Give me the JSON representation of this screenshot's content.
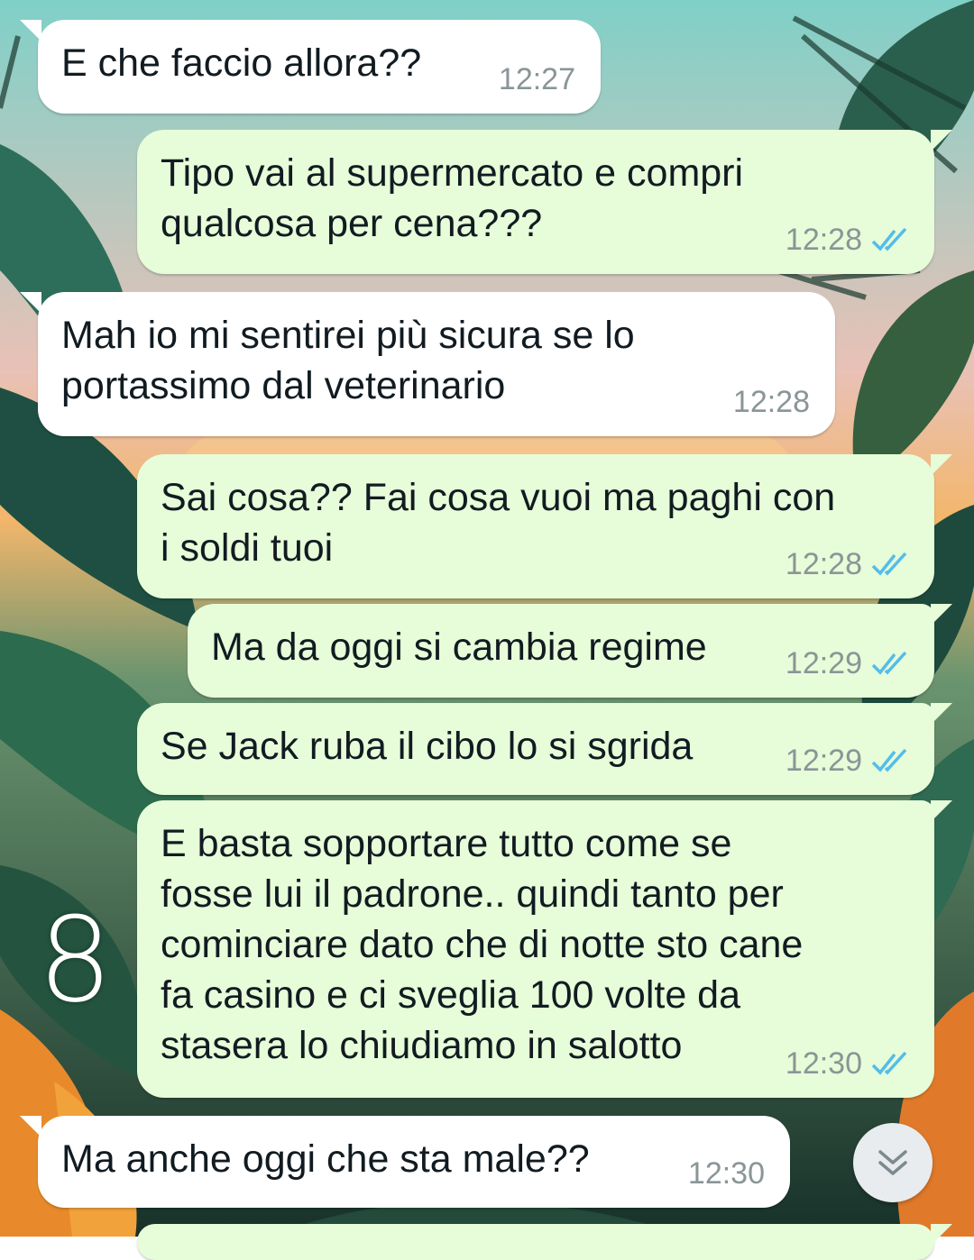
{
  "messages": [
    {
      "dir": "in",
      "text": "E che faccio allora??",
      "time": "12:27"
    },
    {
      "dir": "out",
      "text": "Tipo vai al supermercato e compri\nqualcosa per cena???",
      "time": "12:28"
    },
    {
      "dir": "in",
      "text": "Mah io mi sentirei più sicura se lo\nportassimo dal veterinario",
      "time": "12:28"
    },
    {
      "dir": "out",
      "text": "Sai cosa?? Fai cosa vuoi ma paghi con\ni soldi tuoi",
      "time": "12:28"
    },
    {
      "dir": "out",
      "text": "Ma da oggi si cambia regime",
      "time": "12:29"
    },
    {
      "dir": "out",
      "text": "Se Jack ruba il cibo lo si sgrida",
      "time": "12:29"
    },
    {
      "dir": "out",
      "text": "E basta sopportare tutto come se\nfosse lui il padrone.. quindi tanto per\ncominciare dato che di notte sto cane\nfa casino e ci sveglia 100 volte da\nstasera lo chiudiamo in salotto",
      "time": "12:30"
    },
    {
      "dir": "in",
      "text": "Ma anche oggi che sta male??",
      "time": "12:30"
    }
  ],
  "overlay_mark": "8",
  "icons": {
    "read_receipt": "double-check-icon",
    "scroll": "chevron-double-down-icon"
  },
  "colors": {
    "incoming": "#ffffff",
    "outgoing": "#e7fcd8",
    "read_tick": "#53bdeb",
    "time": "#8a9597"
  }
}
